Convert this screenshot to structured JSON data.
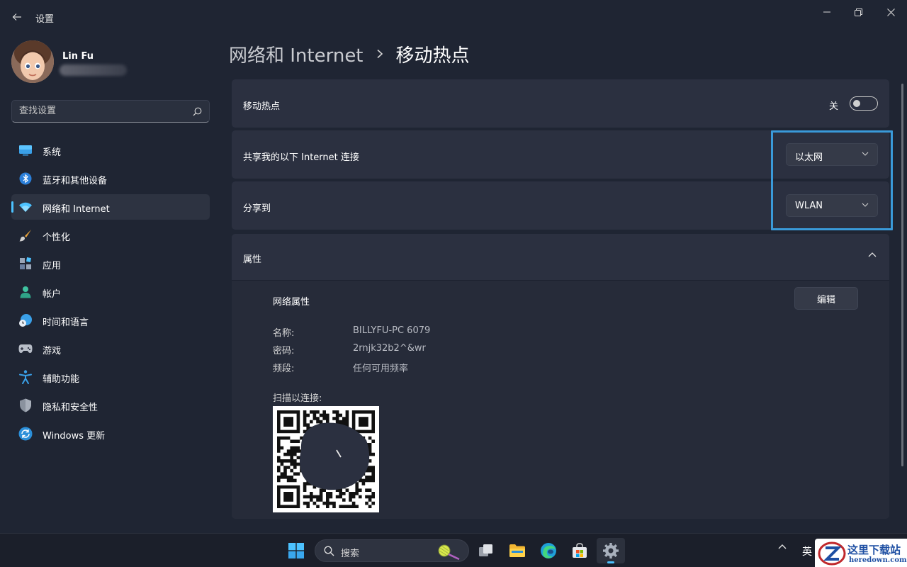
{
  "titlebar": {
    "app_title": "设置"
  },
  "profile": {
    "name": "Lin Fu"
  },
  "search": {
    "placeholder": "查找设置"
  },
  "nav": {
    "items": [
      {
        "label": "系统",
        "icon": "monitor-icon",
        "active": false
      },
      {
        "label": "蓝牙和其他设备",
        "icon": "bluetooth-icon",
        "active": false
      },
      {
        "label": "网络和 Internet",
        "icon": "wifi-icon",
        "active": true
      },
      {
        "label": "个性化",
        "icon": "brush-icon",
        "active": false
      },
      {
        "label": "应用",
        "icon": "apps-icon",
        "active": false
      },
      {
        "label": "帐户",
        "icon": "person-icon",
        "active": false
      },
      {
        "label": "时间和语言",
        "icon": "clock-globe-icon",
        "active": false
      },
      {
        "label": "游戏",
        "icon": "gamepad-icon",
        "active": false
      },
      {
        "label": "辅助功能",
        "icon": "accessibility-icon",
        "active": false
      },
      {
        "label": "隐私和安全性",
        "icon": "shield-icon",
        "active": false
      },
      {
        "label": "Windows 更新",
        "icon": "update-icon",
        "active": false
      }
    ]
  },
  "breadcrumb": {
    "parent": "网络和 Internet",
    "current": "移动热点"
  },
  "hotspot": {
    "title": "移动热点",
    "toggle_label": "关",
    "toggle_on": false
  },
  "share_from": {
    "title": "共享我的以下 Internet 连接",
    "value": "以太网"
  },
  "share_to": {
    "title": "分享到",
    "value": "WLAN"
  },
  "properties": {
    "title": "属性",
    "network_props_title": "网络属性",
    "edit_label": "编辑",
    "fields": [
      {
        "key": "名称:",
        "value": "BILLYFU-PC 6079"
      },
      {
        "key": "密码:",
        "value": "2rnjk32b2^&wr"
      },
      {
        "key": "频段:",
        "value": "任何可用频率"
      }
    ],
    "scan_label": "扫描以连接:"
  },
  "taskbar": {
    "search_label": "搜索",
    "lang": "英"
  },
  "watermark": {
    "line1": "这里下载站",
    "line2": "heredown.com"
  },
  "colors": {
    "accent": "#4cc2ff",
    "highlight": "#3a9ad9",
    "background": "#1f2533",
    "card": "#2b3040"
  }
}
